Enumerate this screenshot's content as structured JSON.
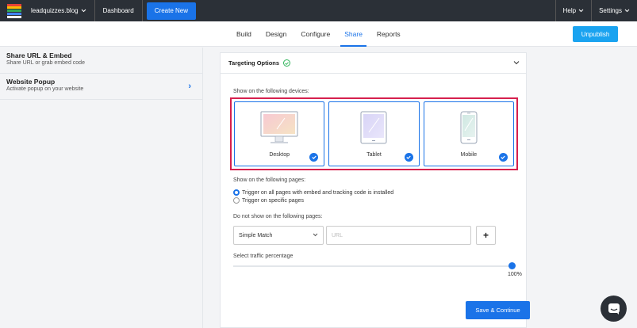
{
  "topbar": {
    "site": "leadquizzes.blog",
    "dashboard": "Dashboard",
    "create": "Create New",
    "help": "Help",
    "settings": "Settings",
    "logo_colors": [
      "#e94235",
      "#fbbc05",
      "#34a853",
      "#4285f4",
      "#ffffff"
    ]
  },
  "tabs": [
    {
      "label": "Build",
      "active": false
    },
    {
      "label": "Design",
      "active": false
    },
    {
      "label": "Configure",
      "active": false
    },
    {
      "label": "Share",
      "active": true
    },
    {
      "label": "Reports",
      "active": false
    }
  ],
  "unpublish": "Unpublish",
  "sidebar": {
    "items": [
      {
        "title": "Share URL & Embed",
        "subtitle": "Share URL or grab embed code"
      },
      {
        "title": "Website Popup",
        "subtitle": "Activate popup on your website"
      }
    ]
  },
  "panel": {
    "title": "Targeting Options",
    "devices_label": "Show on the following devices:",
    "devices": [
      {
        "name": "Desktop",
        "checked": true,
        "icon": "desktop-icon"
      },
      {
        "name": "Tablet",
        "checked": true,
        "icon": "tablet-icon"
      },
      {
        "name": "Mobile",
        "checked": true,
        "icon": "mobile-icon"
      }
    ],
    "pages_label": "Show on the following pages:",
    "radio_all": "Trigger on all pages with embed and tracking code is installed",
    "radio_specific": "Trigger on specific pages",
    "exclude_label": "Do not show on the following pages:",
    "match_select": "Simple Match",
    "url_placeholder": "URL",
    "traffic_label": "Select traffic percentage",
    "traffic_value": "100%",
    "traffic_fraction": 1.0,
    "save": "Save & Continue"
  },
  "colors": {
    "accent": "#1a73e8",
    "highlight": "#d6204e",
    "ok": "#2fb35a"
  }
}
